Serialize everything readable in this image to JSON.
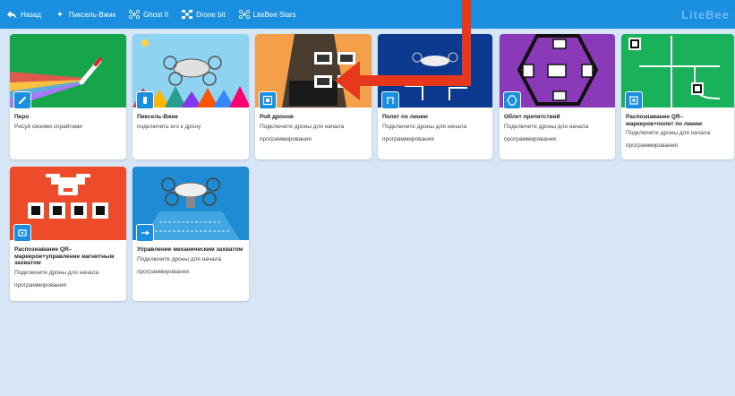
{
  "topbar": {
    "items": [
      {
        "label": "Назад",
        "icon": "back-arrow-icon"
      },
      {
        "label": "Пиксель-Вжик",
        "icon": "sparkle-icon"
      },
      {
        "label": "Ghost II",
        "icon": "drone-icon"
      },
      {
        "label": "Drone bit",
        "icon": "drone-bit-icon"
      },
      {
        "label": "LiteBee Stars",
        "icon": "drone-icon"
      }
    ],
    "brand": "LiteBee"
  },
  "colors": {
    "topbar": "#1a8fe0",
    "background": "#d6e6f7",
    "annotation_arrow": "#e8381c"
  },
  "cards": [
    {
      "title": "Перо",
      "desc": "Рисуй своими спрайтами",
      "icon": "pen-icon"
    },
    {
      "title": "Пиксель-Вжик",
      "desc": "подключить его к дрону",
      "icon": "phone-icon"
    },
    {
      "title": "Рой дронов",
      "desc": "Подключите дроны для начала программирования",
      "icon": "swarm-icon"
    },
    {
      "title": "Полет по линии",
      "desc": "Подключите дроны для начала программирования",
      "icon": "line-follow-icon"
    },
    {
      "title": "Облет препятствий",
      "desc": "Подключите дроны для начала программирования",
      "icon": "obstacle-icon"
    },
    {
      "title": "Распознавание QR–маркеров+полет по линии",
      "desc": "Подключите дроны для начала программирования",
      "icon": "qr-line-icon"
    },
    {
      "title": "Распознавание QR–маркеров+управление магнитным захватом",
      "desc": "Подключите дроны для начала программирования",
      "icon": "qr-magnet-icon"
    },
    {
      "title": "Управление механическим захватом",
      "desc": "Подключите дроны для начала программирования",
      "icon": "gripper-icon"
    }
  ]
}
